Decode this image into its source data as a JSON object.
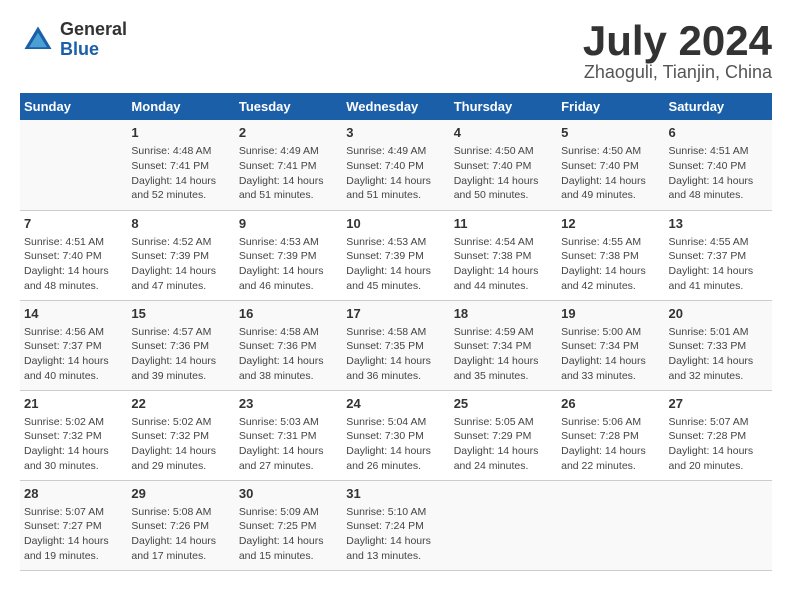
{
  "header": {
    "logo_general": "General",
    "logo_blue": "Blue",
    "month_year": "July 2024",
    "location": "Zhaoguli, Tianjin, China"
  },
  "columns": [
    "Sunday",
    "Monday",
    "Tuesday",
    "Wednesday",
    "Thursday",
    "Friday",
    "Saturday"
  ],
  "weeks": [
    [
      {
        "day": "",
        "info": ""
      },
      {
        "day": "1",
        "info": "Sunrise: 4:48 AM\nSunset: 7:41 PM\nDaylight: 14 hours\nand 52 minutes."
      },
      {
        "day": "2",
        "info": "Sunrise: 4:49 AM\nSunset: 7:41 PM\nDaylight: 14 hours\nand 51 minutes."
      },
      {
        "day": "3",
        "info": "Sunrise: 4:49 AM\nSunset: 7:40 PM\nDaylight: 14 hours\nand 51 minutes."
      },
      {
        "day": "4",
        "info": "Sunrise: 4:50 AM\nSunset: 7:40 PM\nDaylight: 14 hours\nand 50 minutes."
      },
      {
        "day": "5",
        "info": "Sunrise: 4:50 AM\nSunset: 7:40 PM\nDaylight: 14 hours\nand 49 minutes."
      },
      {
        "day": "6",
        "info": "Sunrise: 4:51 AM\nSunset: 7:40 PM\nDaylight: 14 hours\nand 48 minutes."
      }
    ],
    [
      {
        "day": "7",
        "info": "Sunrise: 4:51 AM\nSunset: 7:40 PM\nDaylight: 14 hours\nand 48 minutes."
      },
      {
        "day": "8",
        "info": "Sunrise: 4:52 AM\nSunset: 7:39 PM\nDaylight: 14 hours\nand 47 minutes."
      },
      {
        "day": "9",
        "info": "Sunrise: 4:53 AM\nSunset: 7:39 PM\nDaylight: 14 hours\nand 46 minutes."
      },
      {
        "day": "10",
        "info": "Sunrise: 4:53 AM\nSunset: 7:39 PM\nDaylight: 14 hours\nand 45 minutes."
      },
      {
        "day": "11",
        "info": "Sunrise: 4:54 AM\nSunset: 7:38 PM\nDaylight: 14 hours\nand 44 minutes."
      },
      {
        "day": "12",
        "info": "Sunrise: 4:55 AM\nSunset: 7:38 PM\nDaylight: 14 hours\nand 42 minutes."
      },
      {
        "day": "13",
        "info": "Sunrise: 4:55 AM\nSunset: 7:37 PM\nDaylight: 14 hours\nand 41 minutes."
      }
    ],
    [
      {
        "day": "14",
        "info": "Sunrise: 4:56 AM\nSunset: 7:37 PM\nDaylight: 14 hours\nand 40 minutes."
      },
      {
        "day": "15",
        "info": "Sunrise: 4:57 AM\nSunset: 7:36 PM\nDaylight: 14 hours\nand 39 minutes."
      },
      {
        "day": "16",
        "info": "Sunrise: 4:58 AM\nSunset: 7:36 PM\nDaylight: 14 hours\nand 38 minutes."
      },
      {
        "day": "17",
        "info": "Sunrise: 4:58 AM\nSunset: 7:35 PM\nDaylight: 14 hours\nand 36 minutes."
      },
      {
        "day": "18",
        "info": "Sunrise: 4:59 AM\nSunset: 7:34 PM\nDaylight: 14 hours\nand 35 minutes."
      },
      {
        "day": "19",
        "info": "Sunrise: 5:00 AM\nSunset: 7:34 PM\nDaylight: 14 hours\nand 33 minutes."
      },
      {
        "day": "20",
        "info": "Sunrise: 5:01 AM\nSunset: 7:33 PM\nDaylight: 14 hours\nand 32 minutes."
      }
    ],
    [
      {
        "day": "21",
        "info": "Sunrise: 5:02 AM\nSunset: 7:32 PM\nDaylight: 14 hours\nand 30 minutes."
      },
      {
        "day": "22",
        "info": "Sunrise: 5:02 AM\nSunset: 7:32 PM\nDaylight: 14 hours\nand 29 minutes."
      },
      {
        "day": "23",
        "info": "Sunrise: 5:03 AM\nSunset: 7:31 PM\nDaylight: 14 hours\nand 27 minutes."
      },
      {
        "day": "24",
        "info": "Sunrise: 5:04 AM\nSunset: 7:30 PM\nDaylight: 14 hours\nand 26 minutes."
      },
      {
        "day": "25",
        "info": "Sunrise: 5:05 AM\nSunset: 7:29 PM\nDaylight: 14 hours\nand 24 minutes."
      },
      {
        "day": "26",
        "info": "Sunrise: 5:06 AM\nSunset: 7:28 PM\nDaylight: 14 hours\nand 22 minutes."
      },
      {
        "day": "27",
        "info": "Sunrise: 5:07 AM\nSunset: 7:28 PM\nDaylight: 14 hours\nand 20 minutes."
      }
    ],
    [
      {
        "day": "28",
        "info": "Sunrise: 5:07 AM\nSunset: 7:27 PM\nDaylight: 14 hours\nand 19 minutes."
      },
      {
        "day": "29",
        "info": "Sunrise: 5:08 AM\nSunset: 7:26 PM\nDaylight: 14 hours\nand 17 minutes."
      },
      {
        "day": "30",
        "info": "Sunrise: 5:09 AM\nSunset: 7:25 PM\nDaylight: 14 hours\nand 15 minutes."
      },
      {
        "day": "31",
        "info": "Sunrise: 5:10 AM\nSunset: 7:24 PM\nDaylight: 14 hours\nand 13 minutes."
      },
      {
        "day": "",
        "info": ""
      },
      {
        "day": "",
        "info": ""
      },
      {
        "day": "",
        "info": ""
      }
    ]
  ]
}
